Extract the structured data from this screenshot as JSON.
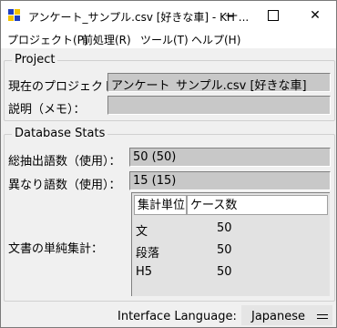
{
  "window": {
    "title": "アンケート_サンプル.csv [好きな車] - KH ...",
    "minimize_label": "—",
    "close_label": "✕"
  },
  "menu": {
    "items": [
      {
        "label": "プロジェクト(P)"
      },
      {
        "label": "前処理(R)"
      },
      {
        "label": "ツール(T)"
      },
      {
        "label": "ヘルプ(H)"
      }
    ]
  },
  "project": {
    "section_title": "Project",
    "current_label": "現在のプロジェクト：",
    "current_value": "アンケート_サンプル.csv [好きな車]",
    "memo_label": "説明（メモ）：",
    "memo_value": ""
  },
  "stats": {
    "section_title": "Database Stats",
    "total_label": "総抽出語数（使用）：",
    "total_value": "50 (50)",
    "distinct_label": "異なり語数（使用）：",
    "distinct_value": "15 (15)",
    "docs_label": "文書の単純集計：",
    "table": {
      "headers": [
        "集計単位",
        "ケース数"
      ],
      "rows": [
        {
          "unit": "文",
          "count": "50"
        },
        {
          "unit": "段落",
          "count": "50"
        },
        {
          "unit": "H5",
          "count": "50"
        }
      ]
    }
  },
  "footer": {
    "language_label": "Interface Language:",
    "language_value": "Japanese"
  },
  "colors": {
    "icon_blue": "#1f3fbf",
    "icon_yellow": "#f2c200",
    "field_bg": "#c8c8c8"
  }
}
